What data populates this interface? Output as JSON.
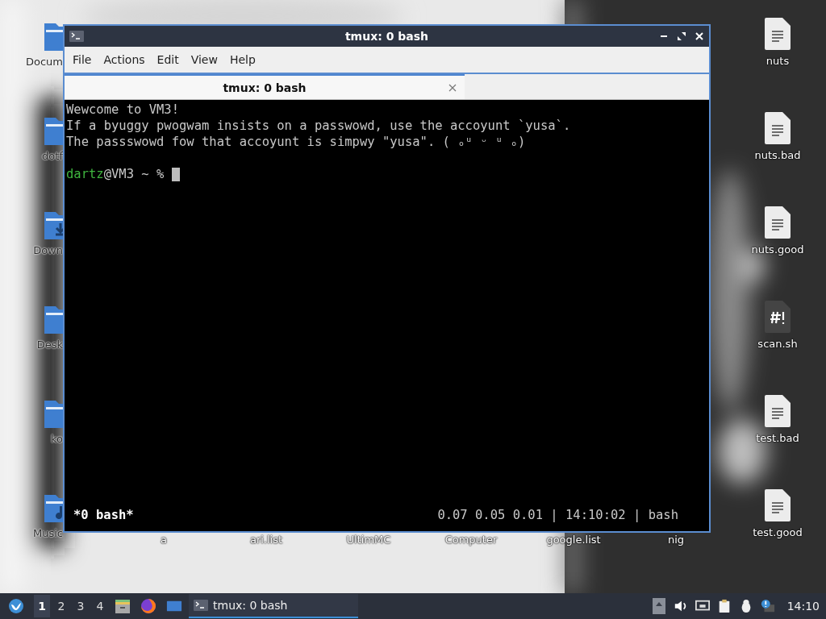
{
  "desktop": {
    "left_icons": [
      {
        "label": "Docum",
        "kind": "folder"
      },
      {
        "label": "dotf",
        "kind": "folder"
      },
      {
        "label": "Down",
        "kind": "download"
      },
      {
        "label": "Desk",
        "kind": "folder"
      },
      {
        "label": "ko",
        "kind": "folder"
      },
      {
        "label": "Music",
        "kind": "music"
      }
    ],
    "bottom_labels": [
      "a",
      "ari.list",
      "UltimMC",
      "Computer",
      "google.list",
      "nig"
    ],
    "right_icons": [
      {
        "label": "nuts",
        "kind": "text"
      },
      {
        "label": "nuts.bad",
        "kind": "text"
      },
      {
        "label": "nuts.good",
        "kind": "text"
      },
      {
        "label": "scan.sh",
        "kind": "script"
      },
      {
        "label": "test.bad",
        "kind": "text"
      },
      {
        "label": "test.good",
        "kind": "text"
      }
    ]
  },
  "window": {
    "title": "tmux: 0 bash",
    "menu": [
      "File",
      "Actions",
      "Edit",
      "View",
      "Help"
    ],
    "tabs": [
      {
        "label": "tmux: 0 bash",
        "selected": true
      }
    ],
    "terminal": {
      "lines": [
        "Wewcome to VM3!",
        "If a byuggy pwogwam insists on a passwowd, use the accoyunt `yusa`.",
        "The passswowd fow that accoyunt is simpwy \"yusa\". ( ₒᵘ ᵕ ᵘ ₒ)"
      ],
      "prompt": {
        "user": "dartz",
        "rest": "@VM3 ~ %"
      }
    },
    "status": {
      "left": "*0 bash*",
      "right": "0.07 0.05 0.01 | 14:10:02 | bash"
    }
  },
  "taskbar": {
    "workspaces": [
      {
        "label": "1",
        "selected": true
      },
      {
        "label": "2",
        "selected": false
      },
      {
        "label": "3",
        "selected": false
      },
      {
        "label": "4",
        "selected": false
      }
    ],
    "tasks": [
      {
        "label": "tmux: 0 bash",
        "selected": true
      }
    ],
    "clock": "14:10"
  }
}
